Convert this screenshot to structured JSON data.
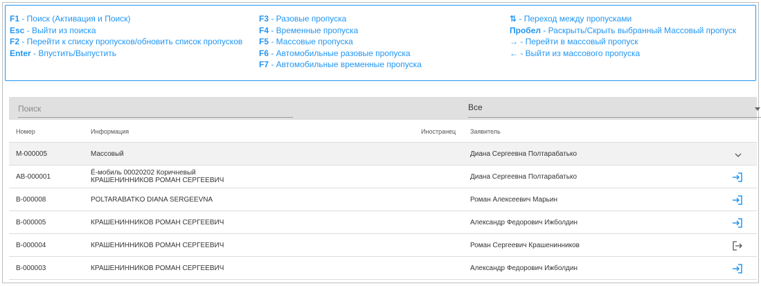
{
  "help": {
    "col1": [
      {
        "key": "F1",
        "text": " - Поиск (Активация и Поиск)"
      },
      {
        "key": "Esc",
        "text": " - Выйти из поиска"
      },
      {
        "key": "F2",
        "text": " - Перейти к списку пропусков/обновить список пропусков"
      },
      {
        "key": "Enter",
        "text": " - Впустить/Выпустить"
      }
    ],
    "col2": [
      {
        "key": "F3",
        "text": " - Разовые пропуска"
      },
      {
        "key": "F4",
        "text": " - Временные пропуска"
      },
      {
        "key": "F5",
        "text": " - Массовые пропуска"
      },
      {
        "key": "F6",
        "text": " - Автомобильные разовые пропуска"
      },
      {
        "key": "F7",
        "text": " - Автомобильные временные пропуска"
      }
    ],
    "col3": [
      {
        "key": "⇅",
        "text": " - Переход между пропусками"
      },
      {
        "key": "Пробел",
        "text": " - Раскрыть/Скрыть выбранный Массовый пропуск"
      },
      {
        "key": "→",
        "text": " - Перейти в массовый пропуск"
      },
      {
        "key": "←",
        "text": " - Выйти из массового пропуска"
      }
    ]
  },
  "search": {
    "placeholder": "Поиск",
    "value": ""
  },
  "filter": {
    "selected": "Все"
  },
  "table": {
    "headers": {
      "number": "Номер",
      "info": "Информация",
      "foreigner": "Иностранец",
      "applicant": "Заявитель"
    },
    "rows": [
      {
        "number": "М-000005",
        "info1": "Массовый",
        "info2": "",
        "applicant": "Диана Сергеевна Полтарабатько",
        "action": "expand"
      },
      {
        "number": "АВ-000001",
        "info1": "Ё-мобиль 00020202 Коричневый",
        "info2": "КРАШЕНИННИКОВ РОМАН СЕРГЕЕВИЧ",
        "applicant": "Диана Сергеевна Полтарабатько",
        "action": "enter"
      },
      {
        "number": "В-000008",
        "info1": "POLTARABATKO DIANA SERGEEVNA",
        "info2": "",
        "applicant": "Роман Алексеевич Марьин",
        "action": "enter"
      },
      {
        "number": "В-000005",
        "info1": "КРАШЕНИННИКОВ РОМАН СЕРГЕЕВИЧ",
        "info2": "",
        "applicant": "Александр Федорович Ижболдин",
        "action": "enter"
      },
      {
        "number": "В-000004",
        "info1": "КРАШЕНИННИКОВ РОМАН СЕРГЕЕВИЧ",
        "info2": "",
        "applicant": "Роман Сергеевич Крашенинников",
        "action": "exit"
      },
      {
        "number": "В-000003",
        "info1": "КРАШЕНИННИКОВ РОМАН СЕРГЕЕВИЧ",
        "info2": "",
        "applicant": "Александр Федорович Ижболдин",
        "action": "enter"
      }
    ]
  },
  "colors": {
    "accent": "#2196f3",
    "exit_icon": "#555555"
  }
}
